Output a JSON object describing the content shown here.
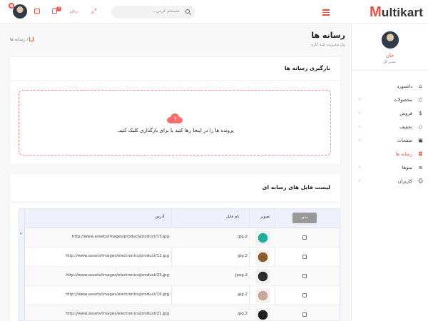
{
  "header": {
    "logo_m": "M",
    "logo_rest": "ultikart",
    "search_placeholder": "جستجو کردن...",
    "lang_label": "زبان",
    "notification_count": "3"
  },
  "sidebar": {
    "profile_name": "جان",
    "profile_role": "مدیر کل.",
    "items": [
      {
        "label": "داشبورد",
        "icon": "home-icon",
        "glyph": "⌂",
        "chev": ""
      },
      {
        "label": "محصولات",
        "icon": "box-icon",
        "glyph": "⬡",
        "chev": "‹"
      },
      {
        "label": "فروش",
        "icon": "dollar-icon",
        "glyph": "$",
        "chev": "‹"
      },
      {
        "label": "تخفیف",
        "icon": "tag-icon",
        "glyph": "◇",
        "chev": "‹"
      },
      {
        "label": "صفحات",
        "icon": "clipboard-icon",
        "glyph": "▣",
        "chev": "‹"
      },
      {
        "label": "رسانه ها",
        "icon": "camera-icon",
        "glyph": "◘",
        "chev": ""
      },
      {
        "label": "منوها",
        "icon": "align-left-icon",
        "glyph": "≡",
        "chev": "‹"
      },
      {
        "label": "کاربران",
        "icon": "users-icon",
        "glyph": "☺",
        "chev": "‹"
      }
    ]
  },
  "page": {
    "title": "رسانه ها",
    "subtitle": "پنل مدیریت چند کاره",
    "breadcrumb": "رسانه ها"
  },
  "upload": {
    "title": "بارگیری رسانه ها",
    "drop_text": "پرونده ها را در اینجا رها کنید یا برای بارگذاری کلیک کنید."
  },
  "list": {
    "title": "لیست فایل های رسانه ای",
    "delete_label": "حذف",
    "col_image": "تصویر",
    "col_name": "نام فایل",
    "col_address": "آدرس",
    "rows": [
      {
        "name": "jpg.2",
        "address": "http://www.assets/images/product/product/13.jpg",
        "color": "#1fae9a"
      },
      {
        "name": "jpg.2",
        "address": "http://www.assets/images/electronics/product/12.jpg",
        "color": "#8b5a2b"
      },
      {
        "name": "jpeg.2",
        "address": "http://www.assets/images/electronics/product/25.jpg",
        "color": "#2b2b2b"
      },
      {
        "name": "jpg.2",
        "address": "http://www.assets/images/electronics/product/16.jpg",
        "color": "#c9a59a"
      },
      {
        "name": "jpg.2",
        "address": "http://www.assets/images/electronics/product/21.jpg",
        "color": "#1e1e1e"
      }
    ]
  },
  "colors": {
    "accent": "#ff4c3b",
    "dropzone_border": "#ff8a80"
  }
}
